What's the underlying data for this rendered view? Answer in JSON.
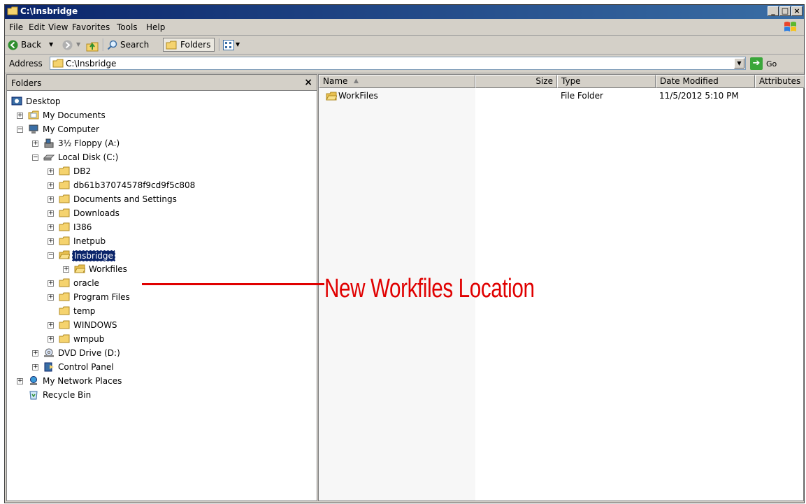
{
  "window": {
    "title": "C:\\Insbridge",
    "buttons": {
      "minimize": "_",
      "maximize": "□",
      "close": "×"
    }
  },
  "menu": {
    "items": [
      {
        "label": "File"
      },
      {
        "label": "Edit"
      },
      {
        "label": "View"
      },
      {
        "label": "Favorites"
      },
      {
        "label": "Tools"
      },
      {
        "label": "Help"
      }
    ]
  },
  "toolbar": {
    "back_label": "Back",
    "search_label": "Search",
    "folders_label": "Folders"
  },
  "address": {
    "label": "Address",
    "value": "C:\\Insbridge",
    "go_label": "Go"
  },
  "folders_pane": {
    "title": "Folders",
    "close": "×",
    "tree": [
      {
        "label": "Desktop",
        "icon": "desktop-icon"
      },
      {
        "label": "My Documents",
        "icon": "my-documents-icon"
      },
      {
        "label": "My Computer",
        "icon": "computer-icon"
      },
      {
        "label": "3½ Floppy (A:)",
        "icon": "floppy-icon"
      },
      {
        "label": "Local Disk (C:)",
        "icon": "disk-icon"
      },
      {
        "label": "DB2",
        "icon": "folder-icon"
      },
      {
        "label": "db61b37074578f9cd9f5c808",
        "icon": "folder-icon"
      },
      {
        "label": "Documents and Settings",
        "icon": "folder-icon"
      },
      {
        "label": "Downloads",
        "icon": "folder-icon"
      },
      {
        "label": "I386",
        "icon": "folder-icon"
      },
      {
        "label": "Inetpub",
        "icon": "folder-icon"
      },
      {
        "label": "Insbridge",
        "icon": "open-folder-icon",
        "selected": true
      },
      {
        "label": "Workfiles",
        "icon": "open-folder-icon"
      },
      {
        "label": "oracle",
        "icon": "folder-icon"
      },
      {
        "label": "Program Files",
        "icon": "folder-icon"
      },
      {
        "label": "temp",
        "icon": "folder-icon"
      },
      {
        "label": "WINDOWS",
        "icon": "folder-icon"
      },
      {
        "label": "wmpub",
        "icon": "folder-icon"
      },
      {
        "label": "DVD Drive (D:)",
        "icon": "dvd-icon"
      },
      {
        "label": "Control Panel",
        "icon": "control-panel-icon"
      },
      {
        "label": "My Network Places",
        "icon": "network-icon"
      },
      {
        "label": "Recycle Bin",
        "icon": "recycle-bin-icon"
      }
    ]
  },
  "file_list": {
    "columns": [
      "Name",
      "Size",
      "Type",
      "Date Modified",
      "Attributes"
    ],
    "rows": [
      {
        "name": "WorkFiles",
        "size": "",
        "type": "File Folder",
        "date_modified": "11/5/2012 5:10 PM",
        "attributes": ""
      }
    ]
  },
  "annotation": {
    "text": "New Workfiles Location",
    "color": "#e00000"
  },
  "colors": {
    "title_bar": "#0a246a",
    "selection": "#0a246a",
    "chrome": "#d4d0c8"
  }
}
